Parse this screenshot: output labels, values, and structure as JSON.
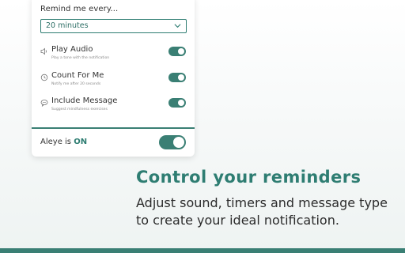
{
  "settings": {
    "remind_label": "Remind me every...",
    "interval_value": "20 minutes",
    "options": [
      {
        "title": "Play Audio",
        "subtitle": "Play a tone with the notification",
        "icon": "speaker-icon",
        "enabled": true
      },
      {
        "title": "Count For Me",
        "subtitle": "Notify me after 20 seconds",
        "icon": "clock-icon",
        "enabled": true
      },
      {
        "title": "Include Message",
        "subtitle": "Suggest mindfulness exercises",
        "icon": "message-icon",
        "enabled": true
      }
    ],
    "status_prefix": "Aleye is",
    "status_value": "ON",
    "master_enabled": true
  },
  "promo": {
    "headline": "Control your reminders",
    "body": "Adjust sound, timers and message type to create your ideal notification."
  },
  "colors": {
    "accent": "#3a7f74",
    "accent_text": "#2e7d72"
  }
}
